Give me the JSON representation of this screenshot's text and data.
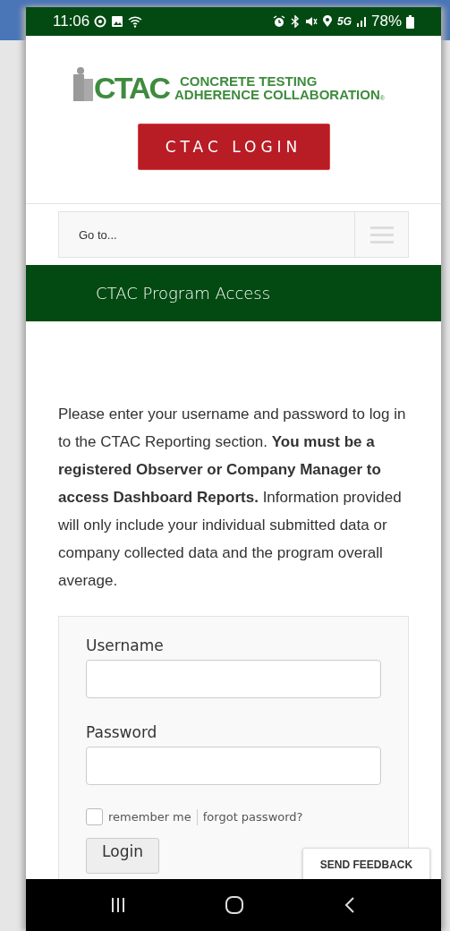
{
  "status_bar": {
    "time": "11:06",
    "network": "5G",
    "battery": "78%"
  },
  "logo": {
    "line_1": "CONCRETE TESTING",
    "line_2": "ADHERENCE COLLABORATION",
    "mark": "CTAC",
    "registered": "®"
  },
  "login_button": "CTAC LOGIN",
  "nav": {
    "placeholder": "Go to..."
  },
  "banner": "CTAC Program Access",
  "intro": "Please enter your username and password to log in to the CTAC Reporting section. **You must be a registered Observer or Company Manager to access Dashboard Reports.** Information provided will only include your individual submitted data or company collected data and the program overall average.",
  "form": {
    "fields": [
      {
        "label": "Username"
      },
      {
        "label": "Password"
      }
    ],
    "remember": {
      "label": "remember me",
      "checked": false
    },
    "forgot": "forgot password?",
    "submit": "Login"
  },
  "feedback_button": "SEND FEEDBACK"
}
